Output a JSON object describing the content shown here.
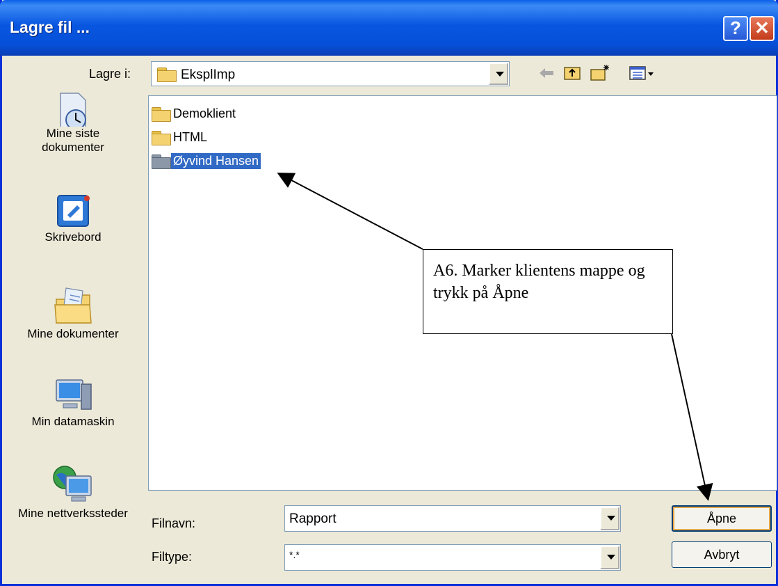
{
  "window": {
    "title": "Lagre fil ...",
    "help_glyph": "?",
    "close_glyph": "✕"
  },
  "location": {
    "label": "Lagre i:",
    "value": "EksplImp"
  },
  "toolbar": {
    "icons": [
      "back-arrow-icon",
      "up-folder-icon",
      "new-folder-icon",
      "view-menu-icon"
    ]
  },
  "places": [
    {
      "label": "Mine siste dokumenter",
      "icon": "recent-documents-icon"
    },
    {
      "label": "Skrivebord",
      "icon": "desktop-icon"
    },
    {
      "label": "Mine dokumenter",
      "icon": "my-documents-icon"
    },
    {
      "label": "Min datamaskin",
      "icon": "my-computer-icon"
    },
    {
      "label": "Mine nettverkssteder",
      "icon": "network-places-icon"
    }
  ],
  "files": [
    {
      "name": "Demoklient",
      "selected": false
    },
    {
      "name": "HTML",
      "selected": false
    },
    {
      "name": "Øyvind Hansen",
      "selected": true
    }
  ],
  "filename": {
    "label": "Filnavn:",
    "value": "Rapport"
  },
  "filetype": {
    "label": "Filtype:",
    "value": "*.*"
  },
  "buttons": {
    "open": "Åpne",
    "cancel": "Avbryt"
  },
  "annotation": {
    "text": "A6. Marker klientens mappe og trykk på Åpne"
  },
  "colors": {
    "selection": "#316AC5",
    "titlebar": "#0A5FE8",
    "dialog_bg": "#ECE9D8"
  }
}
